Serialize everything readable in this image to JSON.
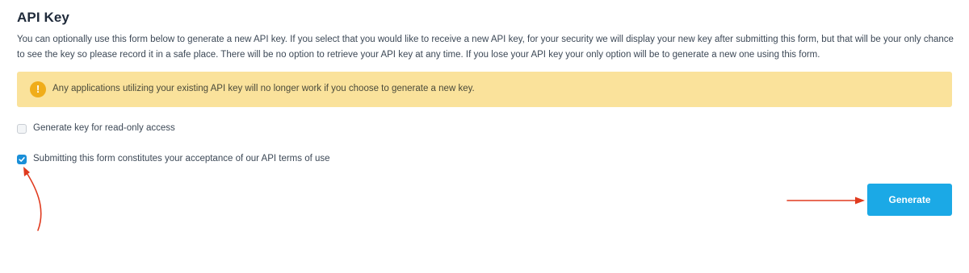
{
  "api_key_section": {
    "title": "API Key",
    "description": "You can optionally use this form below to generate a new API key. If you select that you would like to receive a new API key, for your security we will display your new key after submitting this form, but that will be your only chance to see the key so please record it in a safe place. There will be no option to retrieve your API key at any time. If you lose your API key your only option will be to generate a new one using this form.",
    "alert": {
      "icon": "exclamation-icon",
      "icon_glyph": "!",
      "text": "Any applications utilizing your existing API key will no longer work if you choose to generate a new key."
    },
    "options": [
      {
        "label": "Generate key for read-only access",
        "checked": false
      },
      {
        "label": "Submitting this form constitutes your acceptance of our API terms of use",
        "checked": true
      }
    ],
    "generate_button": "Generate"
  },
  "colors": {
    "alert_background": "#fae29b",
    "alert_icon": "#f0ad1a",
    "primary_button": "#1ba9e6",
    "checkbox_checked": "#1a8fd8",
    "annotation_arrow": "#e03a1e"
  }
}
